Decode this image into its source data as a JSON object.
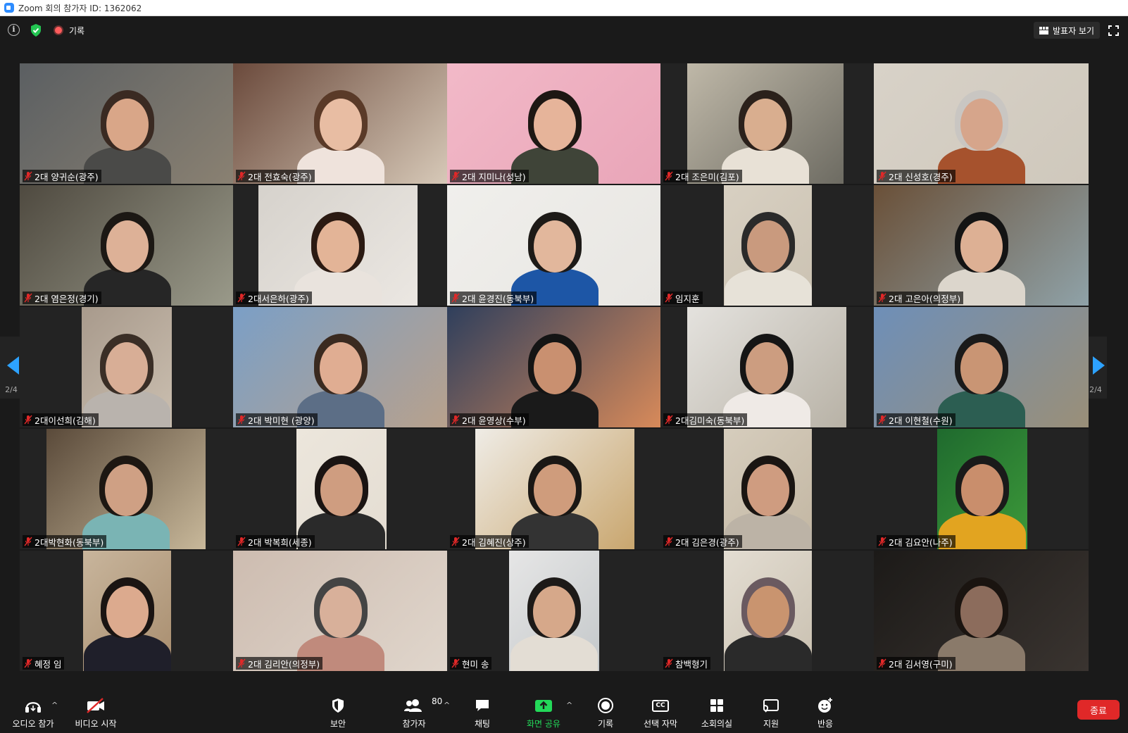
{
  "window": {
    "title": "Zoom 회의 참가자 ID: 1362062"
  },
  "topbar": {
    "record_label": "기록",
    "speaker_view_label": "발표자 보기"
  },
  "pagination": {
    "left": "2/4",
    "right": "2/4"
  },
  "participants": [
    {
      "name": "2대 양귀순(광주)"
    },
    {
      "name": "2대 전효숙(광주)"
    },
    {
      "name": "2대 지미나(성남)"
    },
    {
      "name": "2대 조은미(김포)"
    },
    {
      "name": "2대 신성호(경주)"
    },
    {
      "name": "2대 염은정(경기)"
    },
    {
      "name": "2대서은하(광주)"
    },
    {
      "name": "2대 윤경진(동북부)"
    },
    {
      "name": "임지훈"
    },
    {
      "name": "2대 고은아(의정부)"
    },
    {
      "name": "2대이선희(김해)"
    },
    {
      "name": "2대 박미현 (광양)"
    },
    {
      "name": "2대 윤영상(수부)"
    },
    {
      "name": "2대김미숙(동북부)"
    },
    {
      "name": "2대 이현철(수원)"
    },
    {
      "name": "2대박현화(동북부)"
    },
    {
      "name": "2대 박복희(세종)"
    },
    {
      "name": "2대 김혜진(상주)"
    },
    {
      "name": "2대 김은경(광주)"
    },
    {
      "name": "2대 김요안(나주)"
    },
    {
      "name": "혜정 임"
    },
    {
      "name": "2대 김리안(의정부)"
    },
    {
      "name": "현미 송"
    },
    {
      "name": "참백형기"
    },
    {
      "name": "2대 김서영(구미)"
    }
  ],
  "toolbar": {
    "audio_label": "오디오 참가",
    "video_label": "비디오 시작",
    "security_label": "보안",
    "participants_label": "참가자",
    "participants_count": "80",
    "chat_label": "채팅",
    "share_label": "화면 공유",
    "record_label": "기록",
    "captions_label": "선택 자막",
    "captions_icon_text": "CC",
    "breakout_label": "소회의실",
    "support_label": "지원",
    "reactions_label": "반응",
    "end_label": "종료"
  },
  "colors": {
    "accent_blue": "#2d8cff",
    "share_green": "#23d959",
    "end_red": "#e02828",
    "mic_off_red": "#e02828",
    "arrow_blue": "#2da2ff"
  }
}
